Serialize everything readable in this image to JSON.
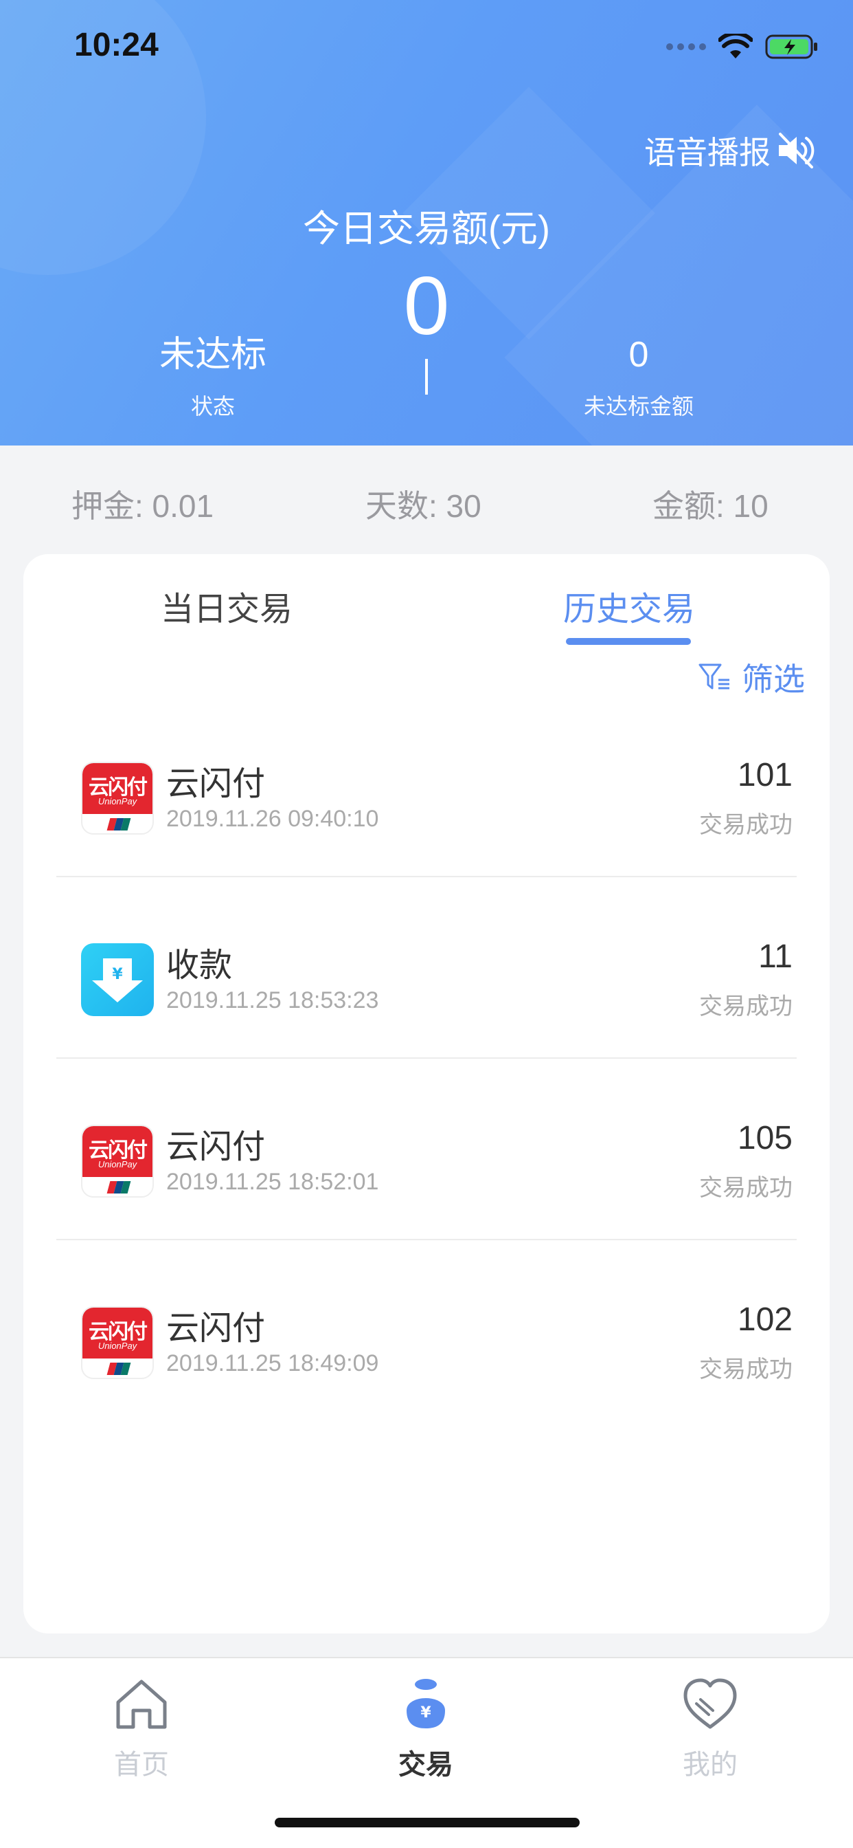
{
  "status_bar": {
    "time": "10:24"
  },
  "header": {
    "voice_label": "语音播报",
    "title": "今日交易额(元)",
    "total": "0",
    "left_value": "未达标",
    "left_label": "状态",
    "right_value": "0",
    "right_label": "未达标金额"
  },
  "info": {
    "deposit": "押金: 0.01",
    "days": "天数: 30",
    "amount": "金额: 10"
  },
  "tabs": {
    "today": "当日交易",
    "history": "历史交易",
    "active": "history"
  },
  "filter_label": "筛选",
  "transactions": [
    {
      "logo": "unionpay-logo",
      "logo_cn": "云闪付",
      "logo_en": "UnionPay",
      "name": "云闪付",
      "time": "2019.11.26 09:40:10",
      "amount": "101",
      "status": "交易成功"
    },
    {
      "logo": "receive-logo",
      "name": "收款",
      "time": "2019.11.25 18:53:23",
      "amount": "11",
      "status": "交易成功"
    },
    {
      "logo": "unionpay-logo",
      "logo_cn": "云闪付",
      "logo_en": "UnionPay",
      "name": "云闪付",
      "time": "2019.11.25 18:52:01",
      "amount": "105",
      "status": "交易成功"
    },
    {
      "logo": "unionpay-logo",
      "logo_cn": "云闪付",
      "logo_en": "UnionPay",
      "name": "云闪付",
      "time": "2019.11.25 18:49:09",
      "amount": "102",
      "status": "交易成功"
    }
  ],
  "tabbar": {
    "home": "首页",
    "trade": "交易",
    "mine": "我的",
    "active": "trade"
  },
  "colors": {
    "accent": "#5b8ef0",
    "header_gradient_start": "#6aaaf5",
    "header_gradient_end": "#5b93f3",
    "unionpay_red": "#e3262f",
    "receive_cyan": "#1fb3ee"
  }
}
